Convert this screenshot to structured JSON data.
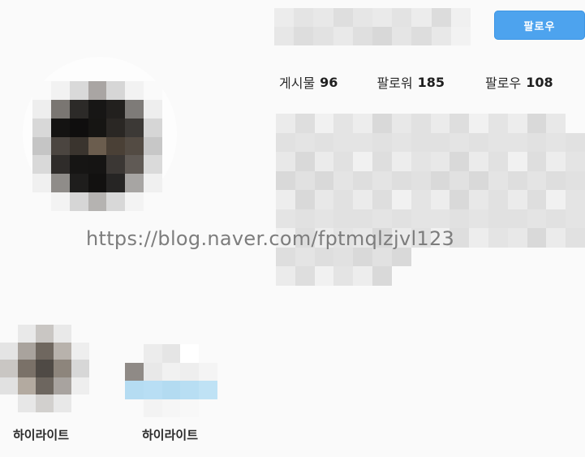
{
  "header": {
    "follow_label": "팔로우"
  },
  "stats": [
    {
      "label": "게시물",
      "value": "96"
    },
    {
      "label": "팔로워",
      "value": "185"
    },
    {
      "label": "팔로우",
      "value": "108"
    }
  ],
  "watermark": "https://blog.naver.com/fptmqlzjvl123",
  "highlights": [
    {
      "label": "하이라이트"
    },
    {
      "label": "하이라이트"
    }
  ],
  "colors": {
    "follow_button": "#4da3ee",
    "background": "#fafafa"
  }
}
